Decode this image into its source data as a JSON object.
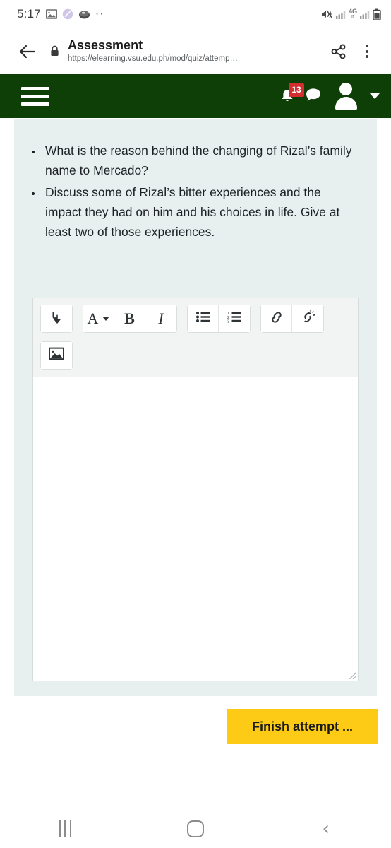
{
  "status_bar": {
    "time": "5:17",
    "left_icons": [
      "gallery-icon",
      "browser-circle-icon",
      "disc-icon",
      "overflow-dots-icon"
    ],
    "overflow_dots": "··",
    "network_label": "4G",
    "right_icons": [
      "mute-vibrate-icon",
      "signal-bars-icon",
      "data-4g-icon",
      "signal-bars-2-icon",
      "battery-icon"
    ]
  },
  "browser": {
    "back_icon": "back-arrow-icon",
    "lock_icon": "lock-icon",
    "title": "Assessment",
    "url": "https://elearning.vsu.edu.ph/mod/quiz/attemp…",
    "share_icon": "share-icon",
    "menu_icon": "kebab-menu-icon"
  },
  "navbar": {
    "menu_icon": "hamburger-icon",
    "notifications_icon": "bell-icon",
    "notifications_count": "13",
    "messages_icon": "message-bubble-icon",
    "avatar_icon": "user-avatar-icon",
    "dropdown_icon": "chevron-down-icon",
    "background_color": "#0e3f06",
    "badge_color": "#d32f2f"
  },
  "question": {
    "bullets": [
      "What is the reason behind the changing of Rizal’s family name to Mercado?",
      "Discuss some of Rizal’s bitter experiences and the impact they had on him and his choices in life. Give at least two of those experiences."
    ],
    "card_color": "#e7f0ef"
  },
  "editor": {
    "toolbar": [
      {
        "name": "expand-toolbar-button",
        "icon": "expand-down-arrow-icon",
        "label": "⤵"
      },
      {
        "name": "font-style-button",
        "icon": "font-style-a-icon",
        "label": "A"
      },
      {
        "name": "bold-button",
        "icon": "bold-icon",
        "label": "B"
      },
      {
        "name": "italic-button",
        "icon": "italic-icon",
        "label": "I"
      },
      {
        "name": "bullet-list-button",
        "icon": "unordered-list-icon",
        "label": ""
      },
      {
        "name": "numbered-list-button",
        "icon": "ordered-list-icon",
        "label": ""
      },
      {
        "name": "link-button",
        "icon": "link-chain-icon",
        "label": ""
      },
      {
        "name": "unlink-button",
        "icon": "broken-chain-icon",
        "label": ""
      },
      {
        "name": "insert-image-button",
        "icon": "image-icon",
        "label": ""
      }
    ],
    "answer_value": "",
    "answer_placeholder": "",
    "resize_handle": "resize-grip-icon"
  },
  "actions": {
    "finish_label": "Finish attempt ...",
    "finish_color": "#fdcb16"
  },
  "android_nav": {
    "recents": "recents-icon",
    "home": "home-icon",
    "back": "‹"
  }
}
